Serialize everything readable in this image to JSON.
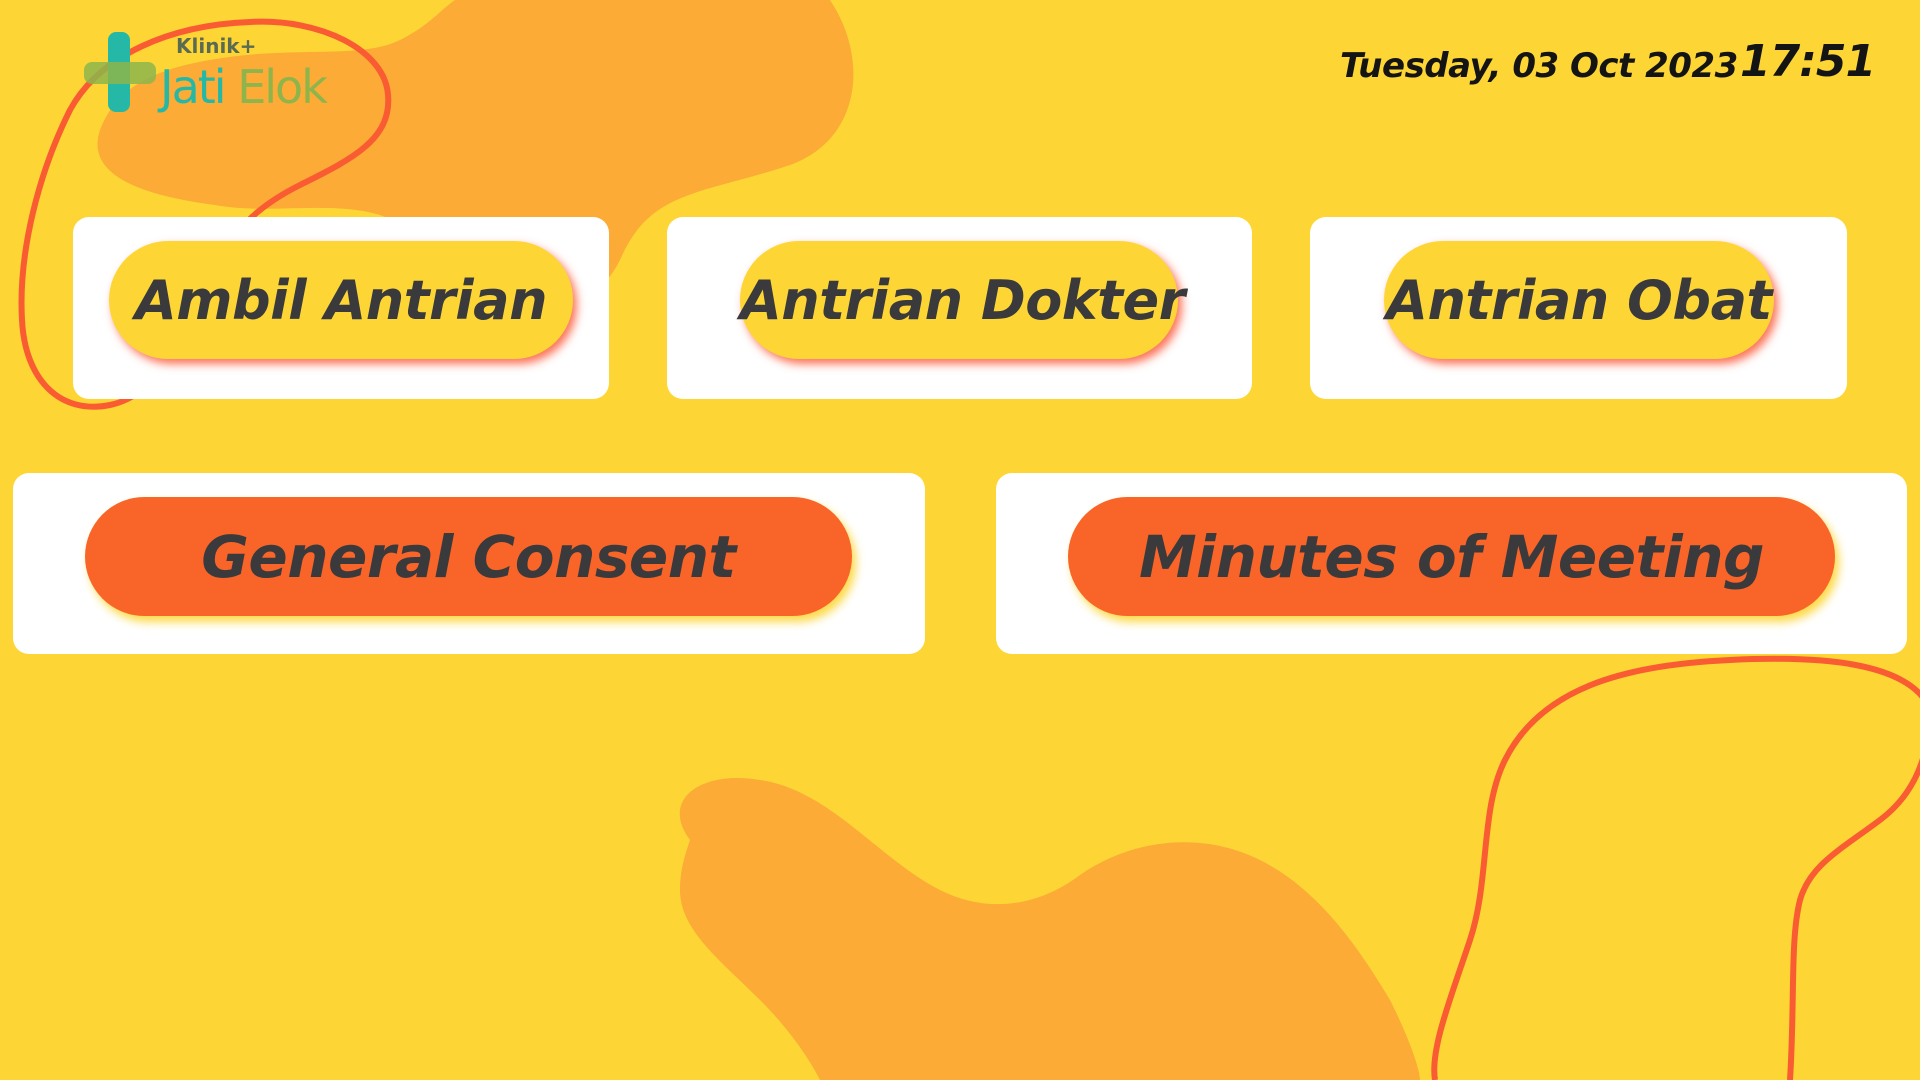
{
  "logo": {
    "prefix": "Klinik+",
    "name_part1": "Jati",
    "name_part2": "Elok"
  },
  "header": {
    "date": "Tuesday, 03 Oct 2023",
    "time": "17:51"
  },
  "menu": {
    "top_row": [
      {
        "label": "Ambil Antrian"
      },
      {
        "label": "Antrian Dokter"
      },
      {
        "label": "Antrian Obat"
      }
    ],
    "bottom_row": [
      {
        "label": "General Consent"
      },
      {
        "label": "Minutes of Meeting"
      }
    ]
  },
  "colors": {
    "background": "#FDD635",
    "blob": "#FBAB36",
    "outline": "#F95C32",
    "card": "#FFFFFF",
    "pill_yellow": "#FDD635",
    "pill_orange": "#F96428",
    "text_dark": "#3A3A3C",
    "logo_teal": "#25B8A6",
    "logo_green": "#8DB54B"
  }
}
